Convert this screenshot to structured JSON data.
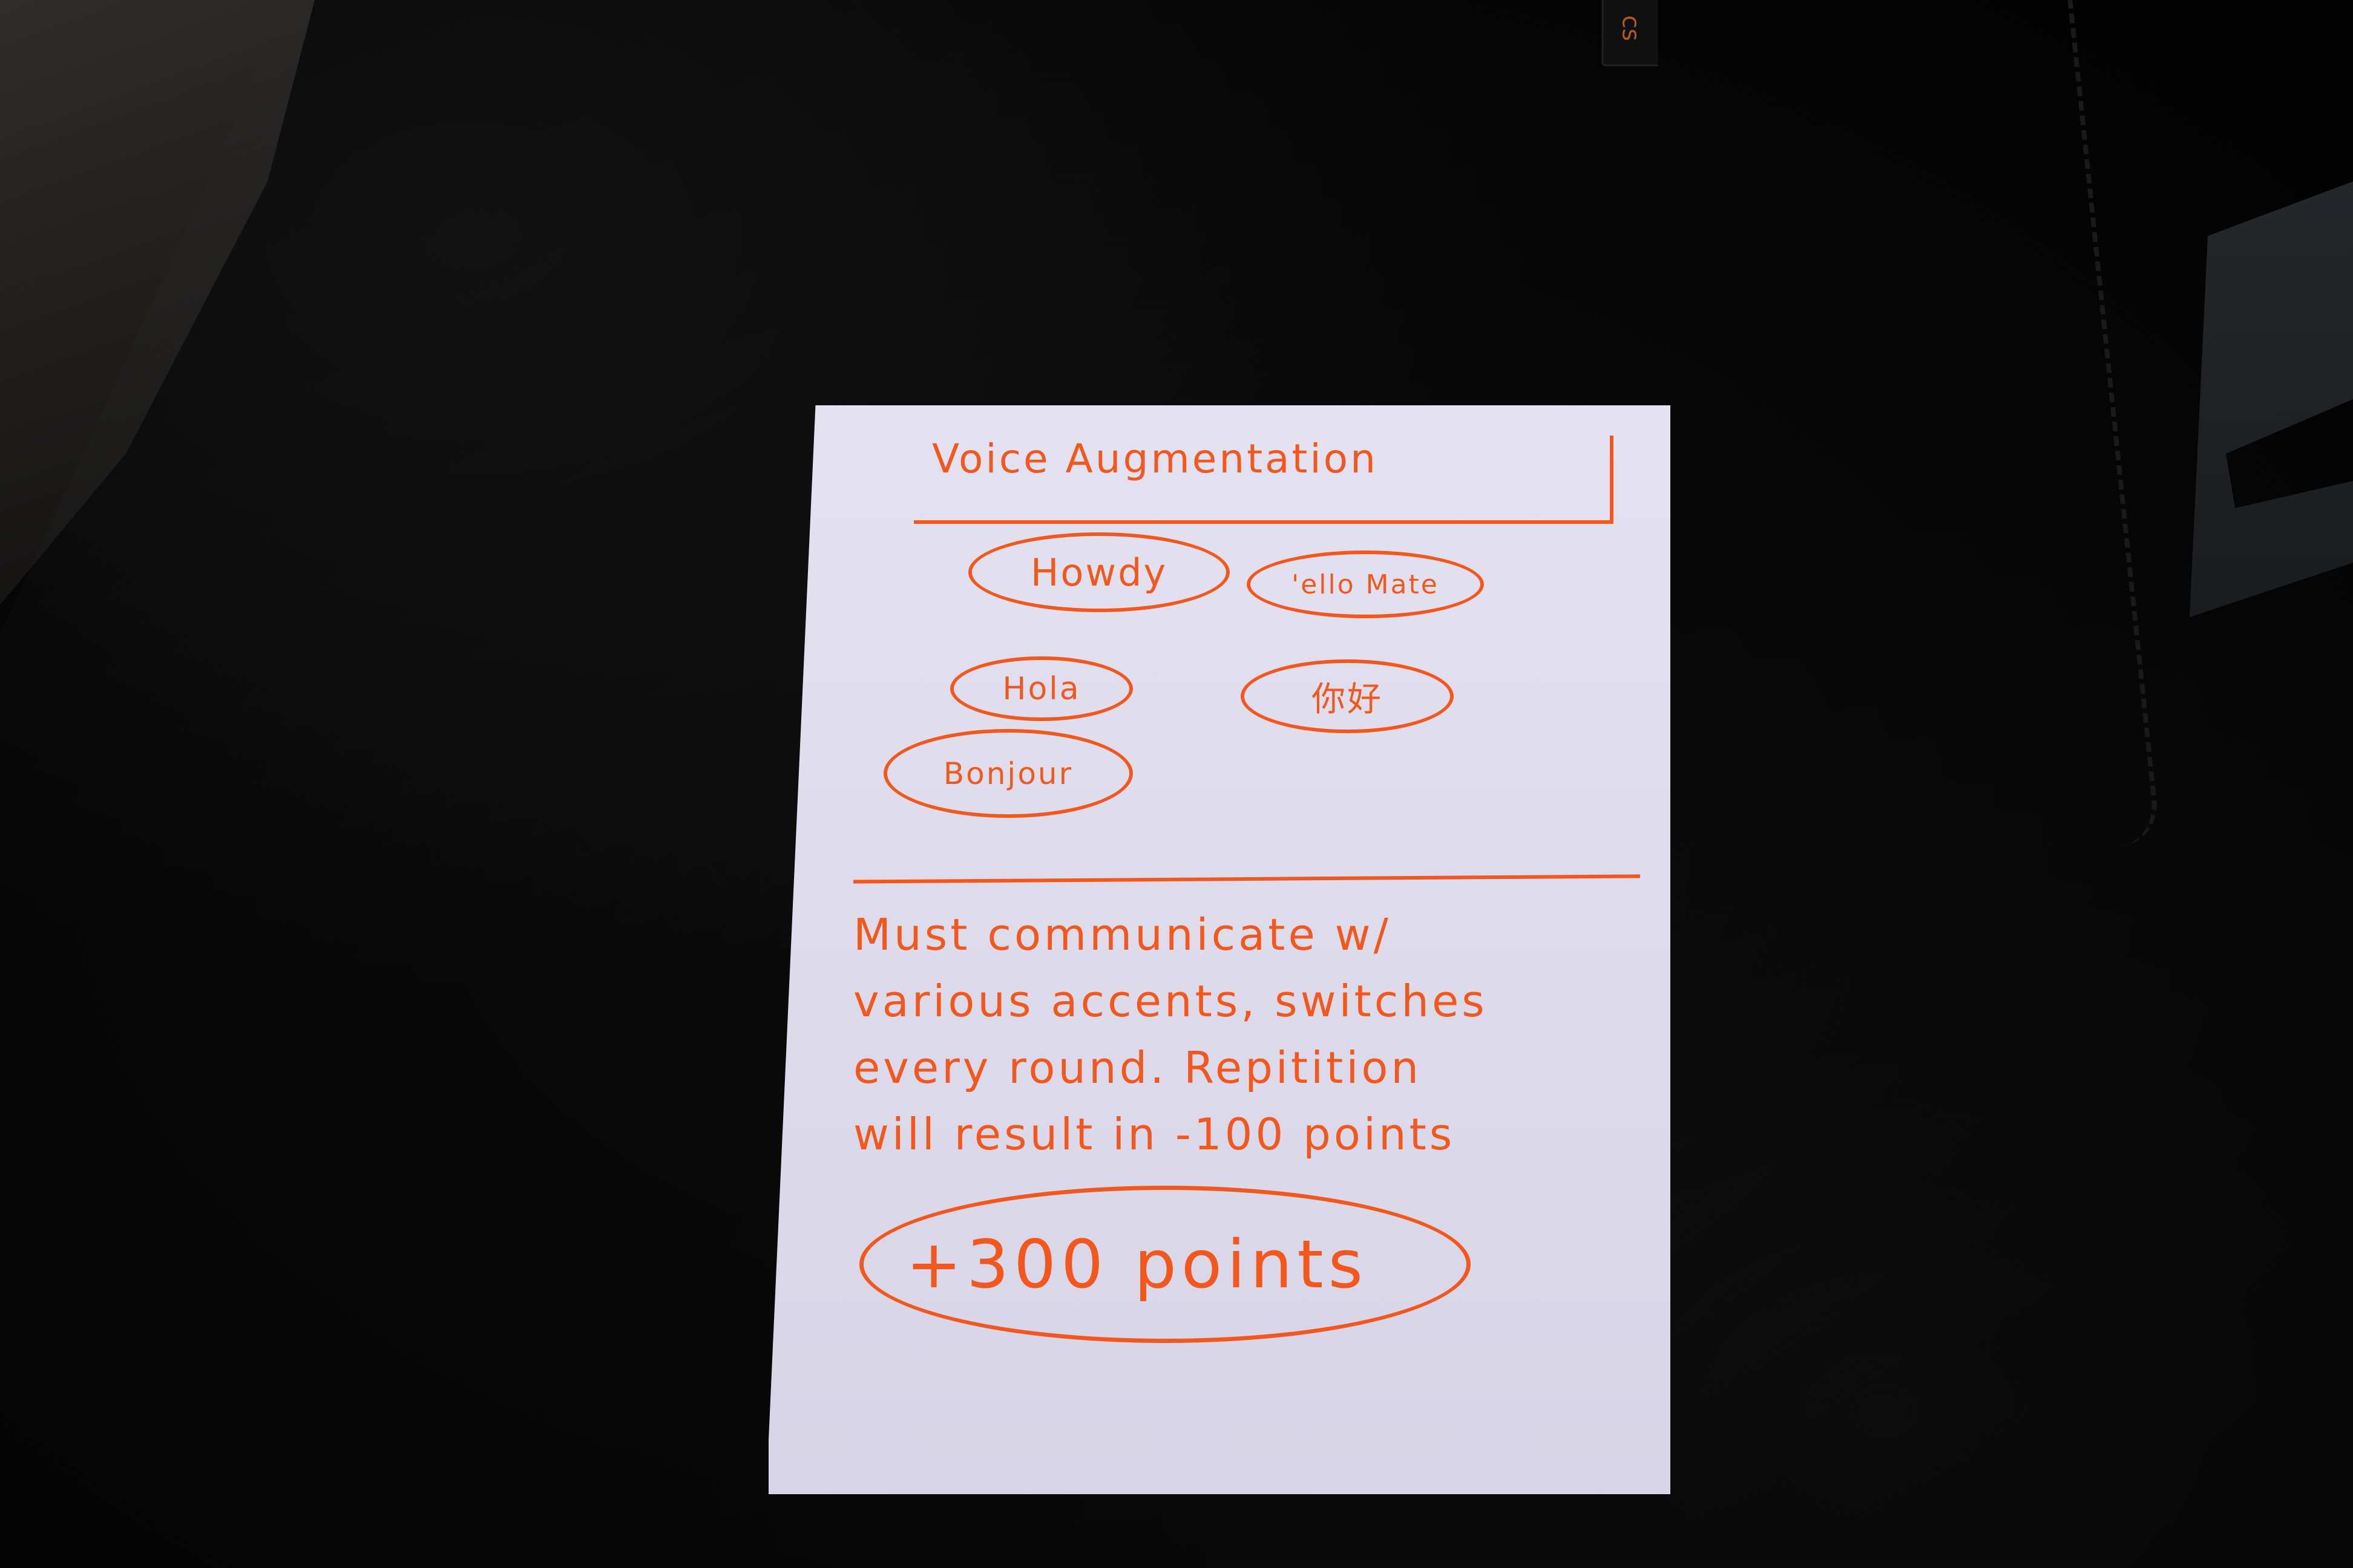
{
  "card": {
    "title": "Voice Augmentation",
    "greetings": [
      "Howdy",
      "'ello Mate",
      "Hola",
      "你好",
      "Bonjour"
    ],
    "description_lines": [
      "Must communicate w/",
      "various accents, switches",
      "every round. Repitition",
      "will result in -100 points"
    ],
    "reward": "+300 points"
  },
  "colors": {
    "ink": "#f2581e",
    "card": "#e2e0ee",
    "background": "#050505"
  }
}
